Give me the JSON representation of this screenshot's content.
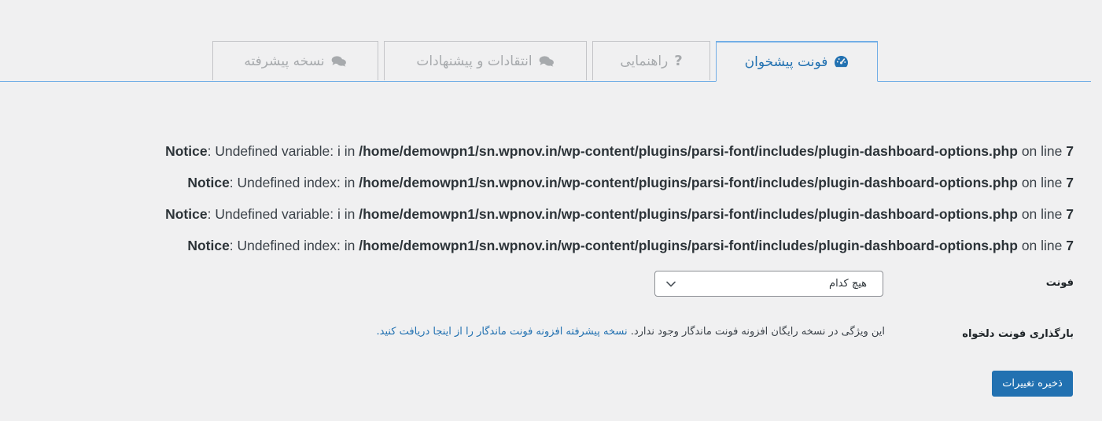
{
  "tabs": [
    {
      "label": "فونت پیشخوان",
      "icon": "dashboard-icon",
      "active": true
    },
    {
      "label": "راهنمایی",
      "icon": "question-icon",
      "active": false
    },
    {
      "label": "انتقادات و پیشنهادات",
      "icon": "comments-icon",
      "active": false
    },
    {
      "label": "نسخه پیشرفته",
      "icon": "comments-icon",
      "active": false
    }
  ],
  "notices": [
    {
      "type": "Notice",
      "message": "Undefined variable: i in",
      "path": "/home/demowpn1/sn.wpnov.in/wp-content/plugins/parsi-font/includes/plugin-dashboard-options.php",
      "on_line": "on line",
      "line": "7"
    },
    {
      "type": "Notice",
      "message": "Undefined index: in",
      "path": "/home/demowpn1/sn.wpnov.in/wp-content/plugins/parsi-font/includes/plugin-dashboard-options.php",
      "on_line": "on line",
      "line": "7"
    },
    {
      "type": "Notice",
      "message": "Undefined variable: i in",
      "path": "/home/demowpn1/sn.wpnov.in/wp-content/plugins/parsi-font/includes/plugin-dashboard-options.php",
      "on_line": "on line",
      "line": "7"
    },
    {
      "type": "Notice",
      "message": "Undefined index: in",
      "path": "/home/demowpn1/sn.wpnov.in/wp-content/plugins/parsi-font/includes/plugin-dashboard-options.php",
      "on_line": "on line",
      "line": "7"
    }
  ],
  "font_field": {
    "label": "فونت",
    "selected": "هیچ کدام"
  },
  "custom_font_field": {
    "label": "بارگذاری فونت دلخواه",
    "description": "این ویژگی در نسخه رایگان افزونه فونت ماندگار وجود ندارد.",
    "link_text": "نسخه پیشرفته افزونه فونت ماندگار را از اینجا دریافت کنید."
  },
  "save_button": "ذخیره تغییرات",
  "colors": {
    "background": "#f0f0f1",
    "accent": "#2271b1",
    "tab_border_active": "#72aee6",
    "tab_inactive_text": "#a7aaad"
  }
}
